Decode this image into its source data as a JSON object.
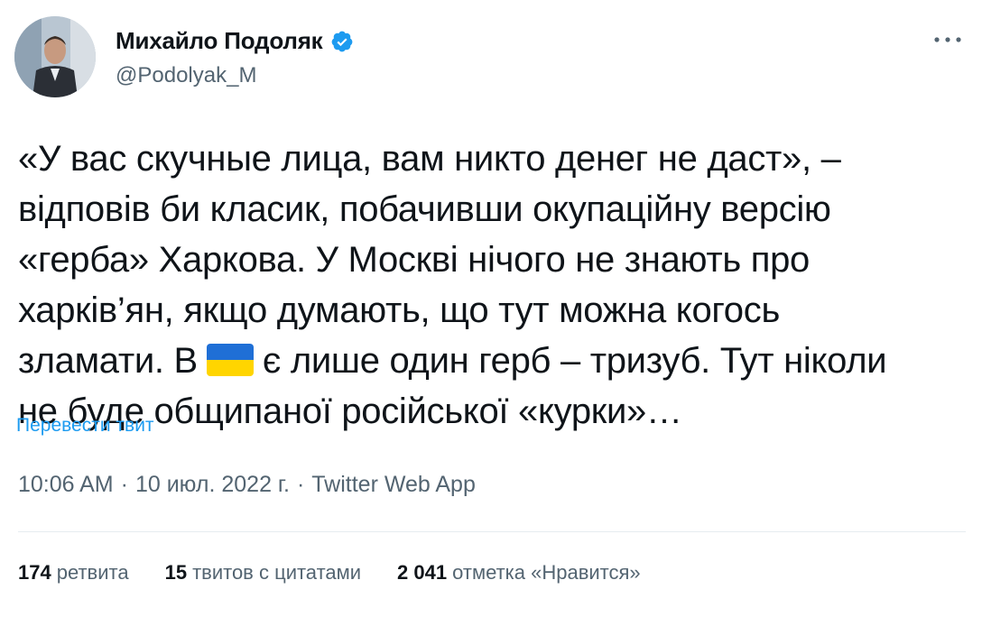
{
  "author": {
    "display_name": "Михайло Подоляк",
    "handle": "@Podolyak_M",
    "verified": true
  },
  "tweet": {
    "lines": {
      "l1": "«У вас скучные лица, вам никто денег не даст», –",
      "l2": "відповів би класик, побачивши окупаційну версію",
      "l3": "«герба» Харкова. У Москві нічого не знають про",
      "l4": "харків’ян, якщо думають, що тут можна когось",
      "l5a": "зламати. В",
      "l5b": "є лише один герб – тризуб. Тут ніколи",
      "l6": "не буде общипаної російської «курки»…"
    },
    "flag_emoji": "ukraine-flag",
    "translate_label": "Перевести твит"
  },
  "meta": {
    "time": "10:06 AM",
    "date": "10 июл. 2022 г.",
    "source": "Twitter Web App",
    "separator": "·"
  },
  "stats": {
    "retweets": {
      "count": "174",
      "label": "ретвита"
    },
    "quotes": {
      "count": "15",
      "label": "твитов с цитатами"
    },
    "likes": {
      "count": "2 041",
      "label": "отметка «Нравится»"
    }
  },
  "colors": {
    "link": "#1d9bf0",
    "secondary_text": "#536471",
    "primary_text": "#0f1419",
    "verified": "#1d9bf0",
    "flag_blue": "#1f6fd6",
    "flag_yellow": "#ffd500"
  },
  "icons": {
    "verified": "verified-badge-icon",
    "more": "more-horizontal-icon"
  }
}
